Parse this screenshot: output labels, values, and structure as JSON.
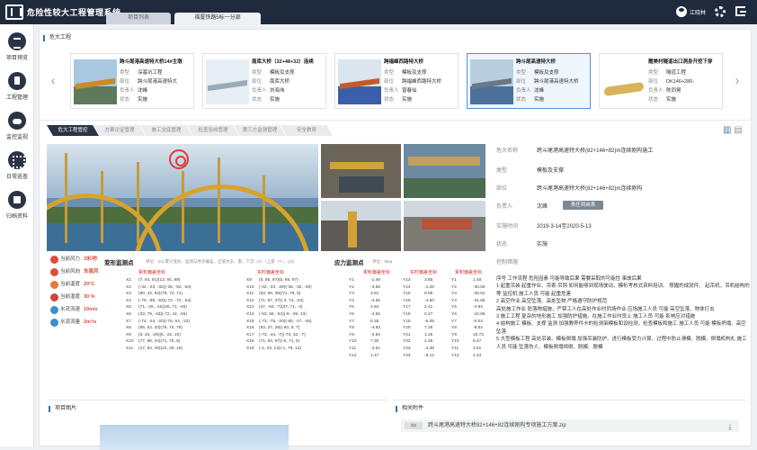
{
  "app": {
    "title": "危险性较大工程管理系统",
    "user": "江晓林"
  },
  "top_tabs": [
    "项目列表",
    "福厦铁路5标一分部"
  ],
  "sidebar": [
    {
      "label": "项目预览",
      "icon": "list-icon"
    },
    {
      "label": "工程管理",
      "icon": "bookmark-icon"
    },
    {
      "label": "监控监视",
      "icon": "cloud-icon"
    },
    {
      "label": "日常巡查",
      "icon": "grid-icon"
    },
    {
      "label": "归档资料",
      "icon": "box-icon"
    }
  ],
  "section_title": "危大工程",
  "cards": [
    {
      "title": "跨斗尾港高速特大桥14#主墩",
      "type": "深基坑工程",
      "part": "跨斗尾港高速特大",
      "owner": "沈峰",
      "status": "实施"
    },
    {
      "title": "南库大桥（32+48+32）连续",
      "type": "模板及支撑",
      "part": "南库大桥",
      "owner": "刘海伟",
      "status": "实施"
    },
    {
      "title": "跨福峰西路特大桥",
      "type": "模板及支撑",
      "part": "跨福峰西路特大桥",
      "owner": "曾春仙",
      "status": "实施"
    },
    {
      "title": "跨斗尾高速特大桥",
      "type": "模板及支撑",
      "part": "跨斗尾港高速特大桥",
      "owner": "沈峰",
      "status": "实施"
    },
    {
      "title": "霞美村隧道出口洞身开挖下穿",
      "type": "隧道工程",
      "part": "DK146+280-",
      "owner": "陈同晃",
      "status": "实施"
    }
  ],
  "card_labels": {
    "type": "类型",
    "part": "部位",
    "owner": "负责人",
    "status": "状态"
  },
  "phase_tabs": [
    "危大工程管控",
    "方案论证管理",
    "施工交底管理",
    "检查验收管理",
    "第三方监测管理",
    "安全教育"
  ],
  "detail": {
    "name_label": "危大名称",
    "name": "跨斗尾港高速特大桥(82+146+82)m连续刚构施工",
    "type_label": "类型",
    "type": "模板及支撑",
    "part_label": "部位",
    "part": "跨斗尾港高速特大桥(82+146+82)m连续刚构",
    "owner_label": "负责人",
    "owner": "沈峰",
    "book_btn": "责任到岗表",
    "time_label": "实施时间",
    "time": "2019-3-14至2020-5-13",
    "status_label": "状态",
    "status": "实施",
    "measures_label": "控制措施",
    "notes": [
      "序号 工作流程 危险因素 可能导致后果 需要采取的可能性 事故后果",
      "1 起重吊装 起重作业、吊索 吊钩 如何能够到现场驶动、模桁考核式资料培训、 撑握的成就件、 起吊机，吊机结构的等 监控机 施工人员 可能 起重危害",
      "2 高空作业 高空坠落、高处坠物 严格遵守防护规范",
      "高处施工作业 防落物措施，严禁工人在高处作业时同场作业 应场施工人员 可能 高空坠落、物体打击",
      "3 施工工程 复杂的地形施工 加强防护措施。在施工作业时员上 施工人员 可能 影响应对措施",
      "4 结构施工 模板、支撑 监测 加强教养件卡的检测架模板和设检测，检查模板和施工 施工人员 可能 模板坍塌、高空坠落",
      "5 大型模板工程 高处吊装、模板倒塌 加强吊装防护、进行模板受力计算、过程中防止滑模、脱模、倒塌机构扎 施工人员 可能 坠落伤人、模板倒塌倾倒、脱模、脱模"
    ]
  },
  "metrics": [
    {
      "label": "当前风力",
      "value": "3米/秒",
      "color": "#e04a3b"
    },
    {
      "label": "当前风向",
      "value": "东南风",
      "color": "#e04a3b"
    },
    {
      "label": "当前温度",
      "value": "20°C",
      "color": "#e07a3b"
    },
    {
      "label": "当前湿度",
      "value": "30 %",
      "color": "#d0453b"
    },
    {
      "label": "水流流速",
      "value": "10m/s",
      "color": "#3b8fd0"
    },
    {
      "label": "水流流量",
      "value": "2m³/s",
      "color": "#3b8fd0"
    }
  ],
  "deform": {
    "title": "变形监测点",
    "note": "单位：(m) 累计变形、监测与原点偏差，正值为东、南、下沉（X）（上游（Y）、(Z)）",
    "col1": "累积偏差坐标",
    "col2": "实时偏差坐标",
    "rows": [
      [
        "X1",
        "(7, 94, 91)(13, 94, 99)",
        "X9",
        "(5, 95, 97)(5, 95, 97)"
      ],
      [
        "X2",
        "(-32, -23, -32)(-35, -52, -54)",
        "X10",
        "(-32, -33, -29)(-38, -32, -29)"
      ],
      [
        "X3",
        "(90, 42, 54)(79, 72, 71)",
        "X11",
        "(63, 96, 39)(71, 75, 5)"
      ],
      [
        "X4",
        "(-70, -95, -63)(-72, -72, -54)",
        "X12",
        "(71, 97, 37)(-3, 74, -23)"
      ],
      [
        "X5",
        "(71, -25, -16)(26, 71, -46)",
        "X13",
        "(47, -94, -7)(37, 71, -4)"
      ],
      [
        "X6",
        "(33, 79, -43)(-72, 42, -46)",
        "X14",
        "(-83, 56, -53)(-8, -26, 13)"
      ],
      [
        "X7",
        "(-74, -24, -20)(-75, 64, -22)",
        "X15",
        "(-73, -75, -20)(-60, -47, -46)"
      ],
      [
        "X8",
        "(96, 63, 33)(79, 74, 79)",
        "X16",
        "(83, 37, 29)(-60, 9, 7)"
      ],
      [
        "X9",
        "(5, 34, -29)(5, -22, 20)",
        "X17",
        "(-73, -44, -7)(-73, 32, -7)"
      ],
      [
        "X10",
        "(77, 96, 34)(71, 75, 5)",
        "X18",
        "(71, 94, 57)(-5, 71, 5)"
      ],
      [
        "X11",
        "(17, 94, 49)(24, 33, 19)",
        "X19",
        "(-1, 33, 13)(-1, 79, 13)"
      ]
    ]
  },
  "stress": {
    "title": "应力监测点",
    "note": "单位：Mpa",
    "col1": "累积偏差坐标",
    "col2": "实时偏差坐标",
    "col3": "累积偏差坐标",
    "rows": [
      [
        "Y1",
        "-1.48",
        "Y13",
        "3.55",
        "Y1",
        "1.48"
      ],
      [
        "Y2",
        "-3.55",
        "Y14",
        "-1.26",
        "Y2",
        "-30.55"
      ],
      [
        "Y3",
        "3.81",
        "Y15",
        "8.05",
        "Y3",
        "-30.51"
      ],
      [
        "Y4",
        "-4.55",
        "Y16",
        "-4.50",
        "Y4",
        "-31.55"
      ],
      [
        "Y5",
        "4.84",
        "Y17",
        "2.41",
        "Y5",
        "-4.94"
      ],
      [
        "Y6",
        "-4.82",
        "Y18",
        "0.27",
        "Y6",
        "-10.56"
      ],
      [
        "Y7",
        "6.35",
        "Y19",
        "-6.05",
        "Y7",
        "-0.04"
      ],
      [
        "Y8",
        "-4.93",
        "Y20",
        "7.36",
        "Y8",
        "-8.54"
      ],
      [
        "Y9",
        "-3.84",
        "Y21",
        "1.25",
        "Y9",
        "10.72"
      ],
      [
        "Y10",
        "7.30",
        "Y22",
        "2.48",
        "Y10",
        "9.47"
      ],
      [
        "Y11",
        "-3.61",
        "Y23",
        "-4.38",
        "Y11",
        "3.61"
      ],
      [
        "Y12",
        "1.47",
        "Y24",
        "-6.12",
        "Y12",
        "2.44"
      ]
    ]
  },
  "project_images_title": "项目图片",
  "attachments_title": "相关附件",
  "attachment": {
    "type": "zip",
    "name": "跨斗尾港高速特大桥82+146+82连续刚构专项施工方案.zip"
  }
}
